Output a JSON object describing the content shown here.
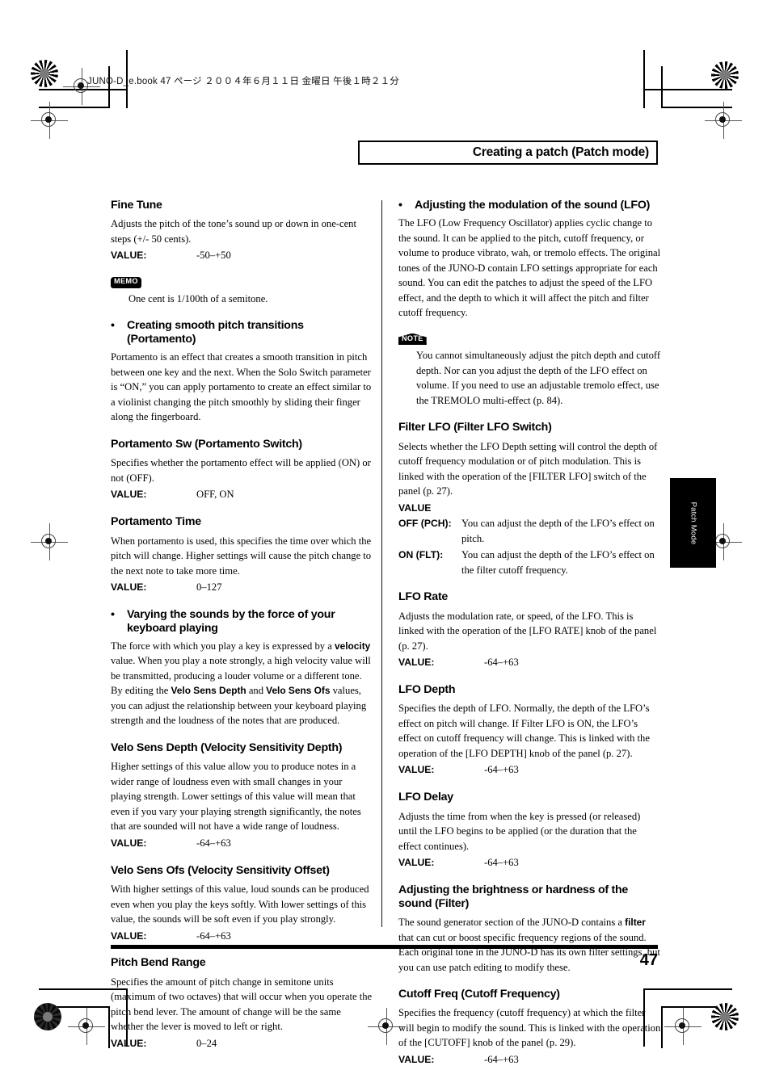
{
  "page": {
    "file_header": "JUNO-D_e.book   47 ページ   ２００４年６月１１日    金曜日    午後１時２１分",
    "chapter_title": "Creating a patch (Patch mode)",
    "thumb_tab": "Patch Mode",
    "page_number": "47"
  },
  "left_column": {
    "fine_tune": {
      "heading": "Fine Tune",
      "body": "Adjusts the pitch of the tone’s sound up or down in one-cent steps (+/- 50 cents).",
      "value_label": "VALUE:",
      "value": "-50–+50",
      "memo_badge": "MEMO",
      "memo_text": "One cent is 1/100th of a semitone."
    },
    "portamento_intro": {
      "bullet": "•",
      "heading": "Creating smooth pitch transitions (Portamento)",
      "body": "Portamento is an effect that creates a smooth transition in pitch between one key and the next. When the Solo Switch parameter is “ON,” you can apply portamento to create an effect similar to a violinist changing the pitch smoothly by sliding their finger along the fingerboard."
    },
    "portamento_sw": {
      "heading": "Portamento Sw (Portamento Switch)",
      "body": "Specifies whether the portamento effect will be applied (ON) or not (OFF).",
      "value_label": "VALUE:",
      "value": "OFF, ON"
    },
    "portamento_time": {
      "heading": "Portamento Time",
      "body": "When portamento is used, this specifies the time over which the pitch will change. Higher settings will cause the pitch change to the next note to take more time.",
      "value_label": "VALUE:",
      "value": "0–127"
    },
    "velocity_intro": {
      "bullet": "•",
      "heading": "Varying the sounds by the force of your keyboard playing",
      "body_1": "The force with which you play a key is expressed by a ",
      "bold_1": "velocity",
      "body_2": " value. When you play a note strongly, a high velocity value will be transmitted, producing a louder volume or a different tone. By editing the ",
      "bold_2": "Velo Sens Depth",
      "body_3": " and ",
      "bold_3": "Velo Sens Ofs",
      "body_4": " values, you can adjust the relationship between your keyboard playing strength and the loudness of the notes that are produced."
    },
    "velo_sens_depth": {
      "heading": "Velo Sens Depth (Velocity Sensitivity Depth)",
      "body": "Higher settings of this value allow you to produce notes in a wider range of loudness even with small changes in your playing strength. Lower settings of this value will mean that even if you vary your playing strength significantly, the notes that are sounded will not have a wide range of loudness.",
      "value_label": "VALUE:",
      "value": "-64–+63"
    },
    "velo_sens_ofs": {
      "heading": "Velo Sens Ofs (Velocity Sensitivity Offset)",
      "body": "With higher settings of this value, loud sounds can be produced even when you play the keys softly. With lower settings of this value, the sounds will be soft even if you play strongly.",
      "value_label": "VALUE:",
      "value": "-64–+63"
    },
    "pitch_bend_range": {
      "heading": "Pitch Bend Range",
      "body": "Specifies the amount of pitch change in semitone units (maximum of two octaves) that will occur when you operate the pitch bend lever. The amount of change will be the same whether the lever is moved to left or right.",
      "value_label": "VALUE:",
      "value": "0–24"
    }
  },
  "right_column": {
    "lfo_intro": {
      "bullet": "•",
      "heading": "Adjusting the modulation of the sound (LFO)",
      "body": "The LFO (Low Frequency Oscillator) applies cyclic change to the sound. It can be applied to the pitch, cutoff frequency, or volume to produce vibrato, wah, or tremolo effects. The original tones of the JUNO-D contain LFO settings appropriate for each sound. You can edit the patches to adjust the speed of the LFO effect, and the depth to which it will affect the pitch and filter cutoff frequency.",
      "note_badge": "NOTE",
      "note_text": "You cannot simultaneously adjust the pitch depth and cutoff depth. Nor can you adjust the depth of the LFO effect on volume. If you need to use an adjustable tremolo effect, use the TREMOLO multi-effect (p. 84)."
    },
    "filter_lfo": {
      "heading": "Filter LFO (Filter LFO Switch)",
      "body": "Selects whether the LFO Depth setting will control the depth of cutoff frequency modulation or of pitch modulation. This is linked with the operation of the [FILTER LFO] switch of the panel (p. 27).",
      "value_label": "VALUE",
      "rows": [
        {
          "label": "OFF (PCH):",
          "text": "You can adjust the depth of the LFO’s effect on pitch."
        },
        {
          "label": "ON (FLT):",
          "text": "You can adjust the depth of the LFO’s effect on the filter cutoff frequency."
        }
      ]
    },
    "lfo_rate": {
      "heading": "LFO Rate",
      "body": "Adjusts the modulation rate, or speed, of the LFO. This is linked with the operation of the [LFO RATE] knob of the panel (p. 27).",
      "value_label": "VALUE:",
      "value": "-64–+63"
    },
    "lfo_depth": {
      "heading": "LFO Depth",
      "body": "Specifies the depth of LFO. Normally, the depth of the LFO’s effect on pitch will change. If Filter LFO is ON, the LFO’s effect on cutoff frequency will change. This is linked with the operation of the [LFO DEPTH] knob of the panel (p. 27).",
      "value_label": "VALUE:",
      "value": "-64–+63"
    },
    "lfo_delay": {
      "heading": "LFO Delay",
      "body": "Adjusts the time from when the key is pressed (or released) until the LFO begins to be applied (or the duration that the effect continues).",
      "value_label": "VALUE:",
      "value": "-64–+63"
    },
    "filter_section": {
      "heading": "Adjusting the brightness or hardness of the sound (Filter)",
      "body_1": "The sound generator section of the JUNO-D contains a ",
      "bold_1": "filter",
      "body_2": " that can cut or boost specific frequency regions of the sound. Each original tone in the JUNO-D has its own filter settings, but you can use patch editing to modify these."
    },
    "cutoff_freq": {
      "heading": "Cutoff Freq (Cutoff Frequency)",
      "body": "Specifies the frequency (cutoff frequency) at which the filter will begin to modify the sound. This is linked with the operation of the [CUTOFF] knob of the panel (p. 29).",
      "value_label": "VALUE:",
      "value": "-64–+63"
    }
  }
}
